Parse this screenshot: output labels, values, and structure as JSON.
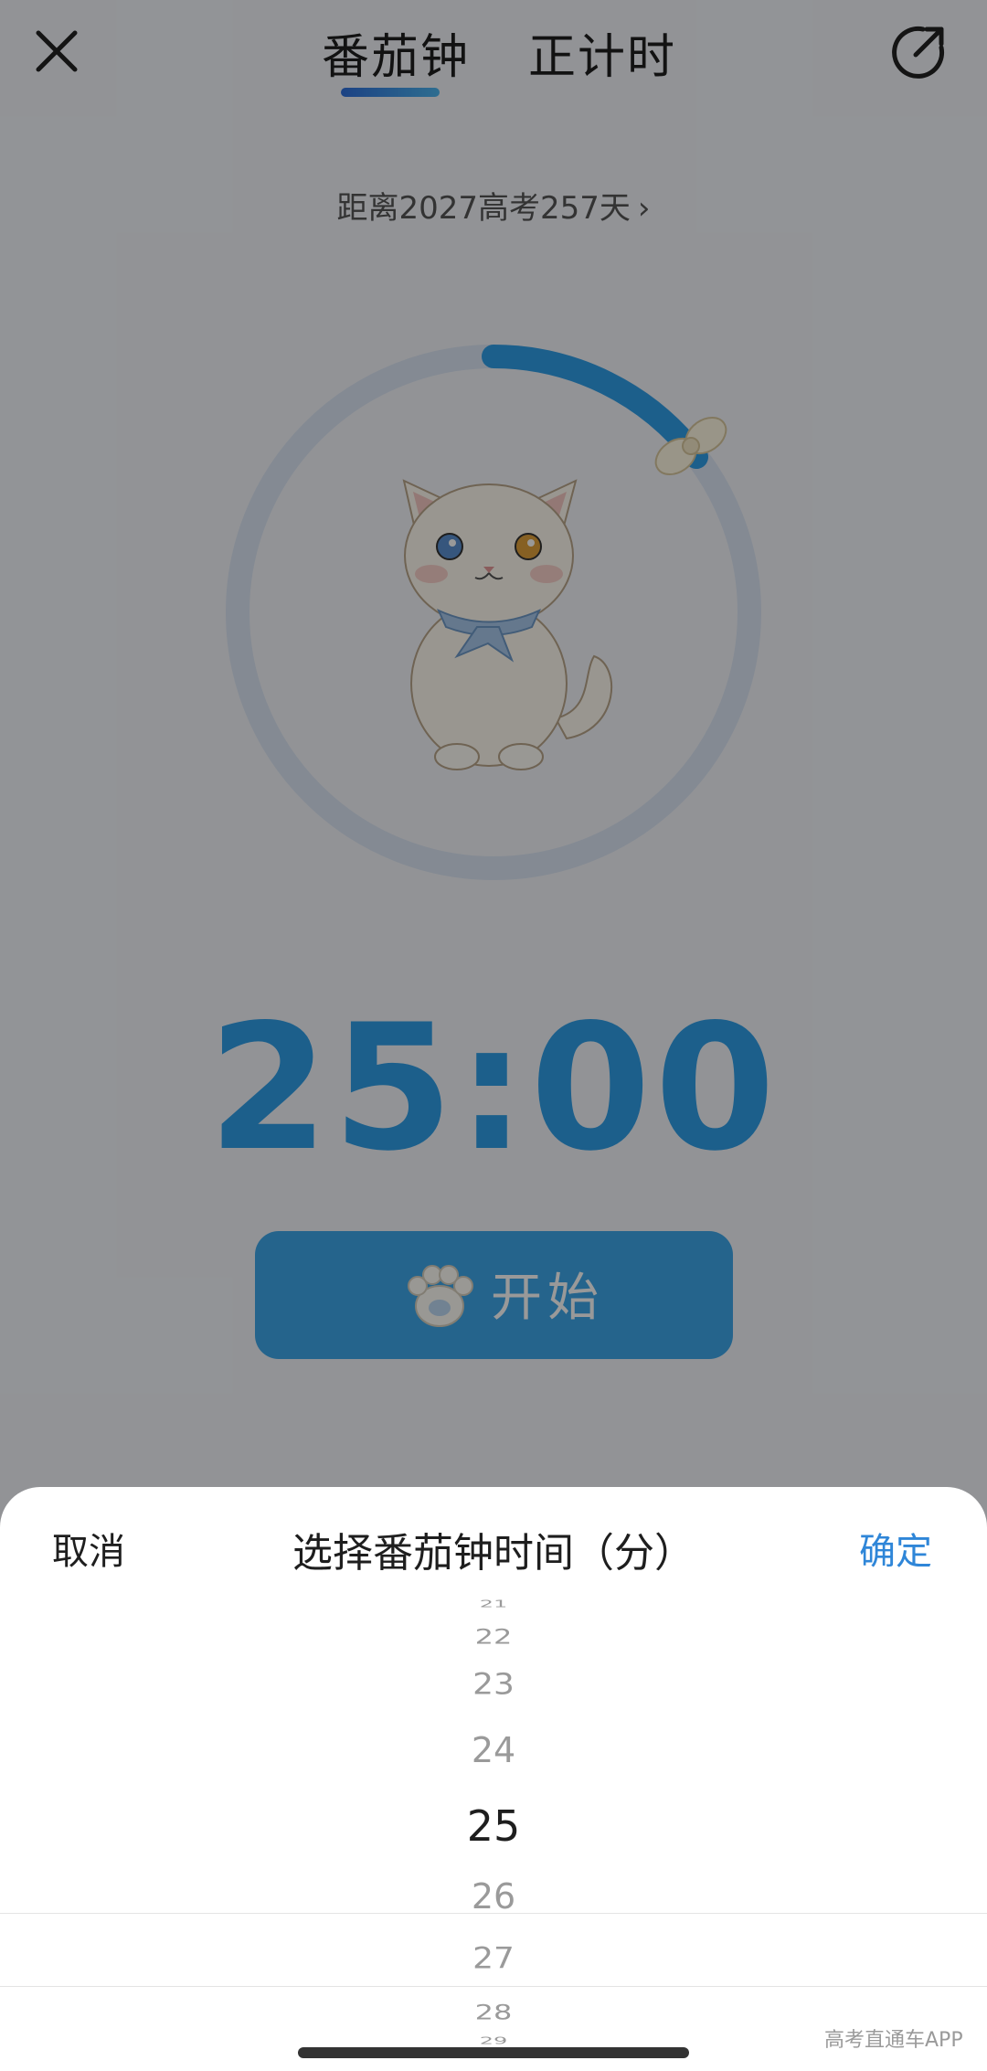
{
  "tabs": [
    "番茄钟",
    "正计时"
  ],
  "countdown_text": "距离2027高考257天",
  "chevron": "›",
  "timer": "25:00",
  "start_label": "开始",
  "sheet": {
    "cancel": "取消",
    "title": "选择番茄钟时间（分）",
    "confirm": "确定"
  },
  "picker": {
    "items": [
      "21",
      "22",
      "23",
      "24",
      "25",
      "26",
      "27",
      "28",
      "29"
    ],
    "selected": "25"
  },
  "watermark": "高考直通车APP",
  "icons": {
    "close": "close-icon",
    "share": "share-external-icon",
    "paw": "paw-icon",
    "cat": "cat-illustration",
    "bow": "bow-knob-icon"
  },
  "colors": {
    "accent": "#2f9ee8",
    "button": "#3ea7ea",
    "confirm": "#2f86d8"
  },
  "progress_ring_fraction": 0.2
}
